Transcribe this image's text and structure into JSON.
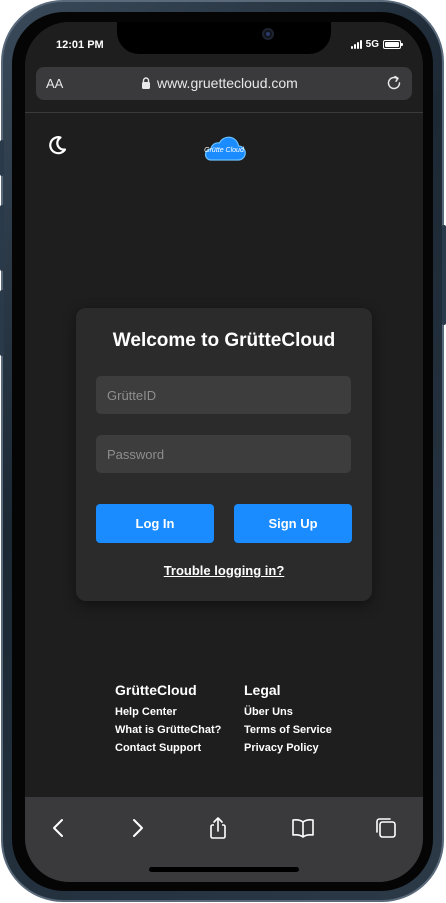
{
  "status_bar": {
    "time": "12:01 PM",
    "network": "5G",
    "battery_level": 1.0
  },
  "browser": {
    "text_size_label": "AA",
    "url": "www.gruettecloud.com"
  },
  "page": {
    "logo_text": "Grütte Cloud",
    "login": {
      "title": "Welcome to GrütteCloud",
      "id_placeholder": "GrütteID",
      "password_placeholder": "Password",
      "login_label": "Log In",
      "signup_label": "Sign Up",
      "trouble_label": "Trouble logging in?"
    },
    "footer": {
      "col1": {
        "heading": "GrütteCloud",
        "links": [
          "Help Center",
          "What is GrütteChat?",
          "Contact Support"
        ]
      },
      "col2": {
        "heading": "Legal",
        "links": [
          "Über Uns",
          "Terms of Service",
          "Privacy Policy"
        ]
      }
    }
  },
  "colors": {
    "background": "#1e1e1e",
    "card": "#2b2b2b",
    "accent": "#1a8cff",
    "input": "#3d3d3d"
  },
  "icons": {
    "theme_toggle": "moon-icon",
    "toolbar": [
      "back-icon",
      "forward-icon",
      "share-icon",
      "bookmarks-icon",
      "tabs-icon"
    ]
  }
}
